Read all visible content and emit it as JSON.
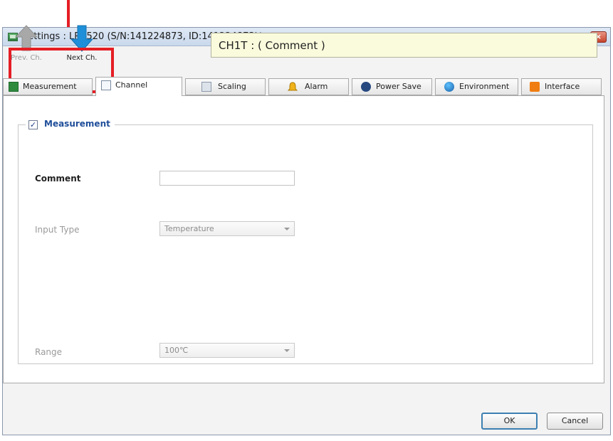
{
  "window": {
    "title": "Settings : LR8520 (S/N:141224873, ID:141224873)*",
    "close_glyph": "×"
  },
  "toolbar": {
    "prev_label": "Prev. Ch.",
    "next_label": "Next Ch.",
    "channel_comment": "CH1T : ( Comment )"
  },
  "tabs": [
    {
      "label": "Measurement",
      "icon": "measurement-icon",
      "active": false
    },
    {
      "label": "Channel",
      "icon": "channel-icon",
      "active": true
    },
    {
      "label": "Scaling",
      "icon": "scaling-icon",
      "active": false
    },
    {
      "label": "Alarm",
      "icon": "bell-icon",
      "active": false
    },
    {
      "label": "Power Save",
      "icon": "bluetooth-icon",
      "active": false
    },
    {
      "label": "Environment",
      "icon": "globe-icon",
      "active": false
    },
    {
      "label": "Interface",
      "icon": "rss-icon",
      "active": false
    }
  ],
  "measurement": {
    "label": "Measurement",
    "checked": true,
    "check_glyph": "✓",
    "comment_label": "Comment",
    "comment_value": "",
    "input_type_label": "Input Type",
    "input_type_value": "Temperature",
    "range_label": "Range",
    "range_value": "100℃"
  },
  "footer": {
    "ok_label": "OK",
    "cancel_label": "Cancel"
  },
  "colors": {
    "highlight": "#e51e25",
    "comment_bg": "#fafbdc",
    "next_arrow": "#1e8fd8",
    "prev_arrow": "#a8a8a8"
  }
}
